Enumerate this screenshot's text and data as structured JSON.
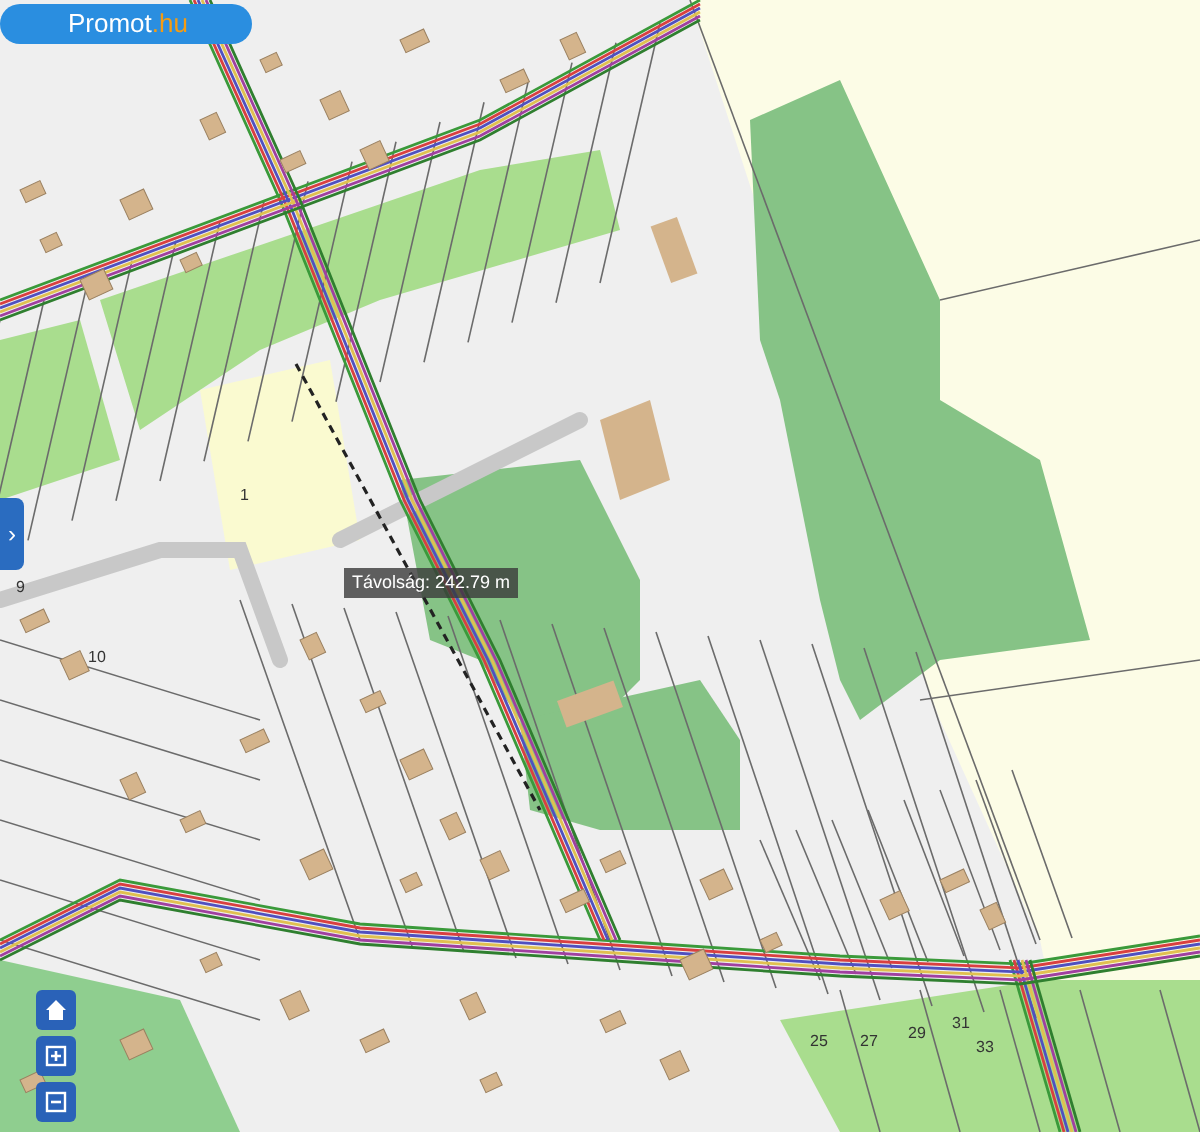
{
  "logo": {
    "name": "Promot",
    "suffix": ".hu"
  },
  "measurement": {
    "label": "Távolság: 242.79 m"
  },
  "map_labels": [
    {
      "text": "1"
    },
    {
      "text": "9"
    },
    {
      "text": "10"
    },
    {
      "text": "25"
    },
    {
      "text": "27"
    },
    {
      "text": "29"
    },
    {
      "text": "31"
    },
    {
      "text": "33"
    }
  ],
  "sidebar_toggle": {
    "label": "›"
  },
  "controls": [
    {
      "kind": "home"
    },
    {
      "kind": "zoom_in"
    },
    {
      "kind": "zoom_out"
    }
  ]
}
